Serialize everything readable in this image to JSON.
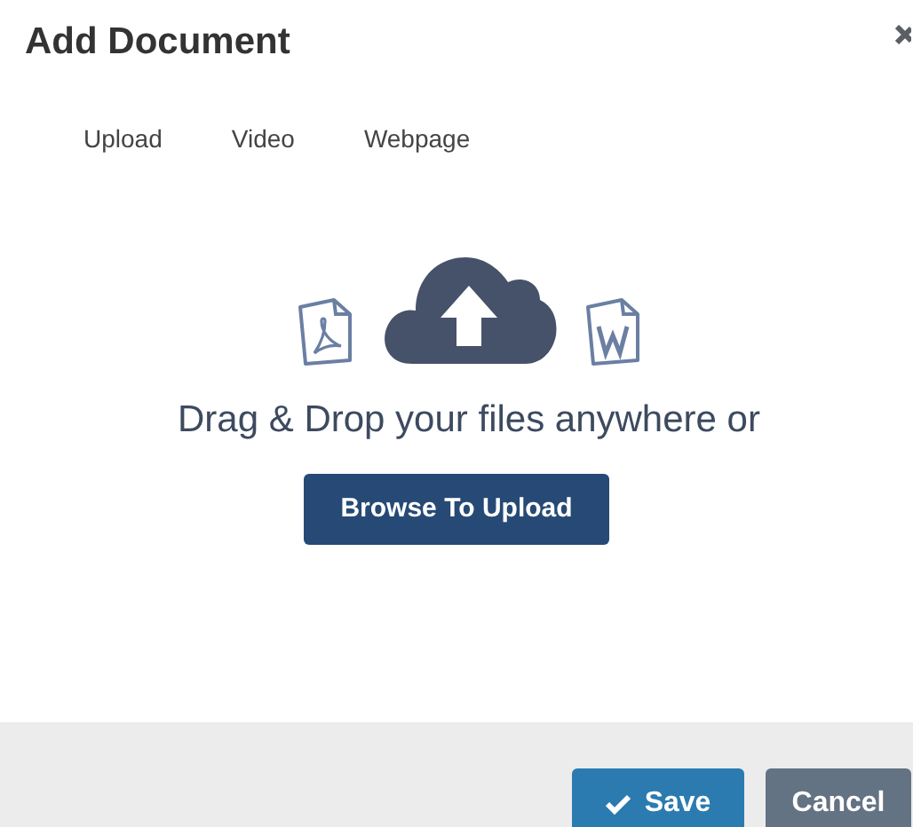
{
  "dialog": {
    "title": "Add Document"
  },
  "tabs": [
    {
      "label": "Upload"
    },
    {
      "label": "Video"
    },
    {
      "label": "Webpage"
    }
  ],
  "dropzone": {
    "message": "Drag & Drop your files anywhere or",
    "button": "Browse To Upload"
  },
  "footer": {
    "buttons": [
      {
        "label": "Save",
        "kind": "primary"
      },
      {
        "label": "Cancel",
        "kind": "secondary"
      }
    ]
  }
}
